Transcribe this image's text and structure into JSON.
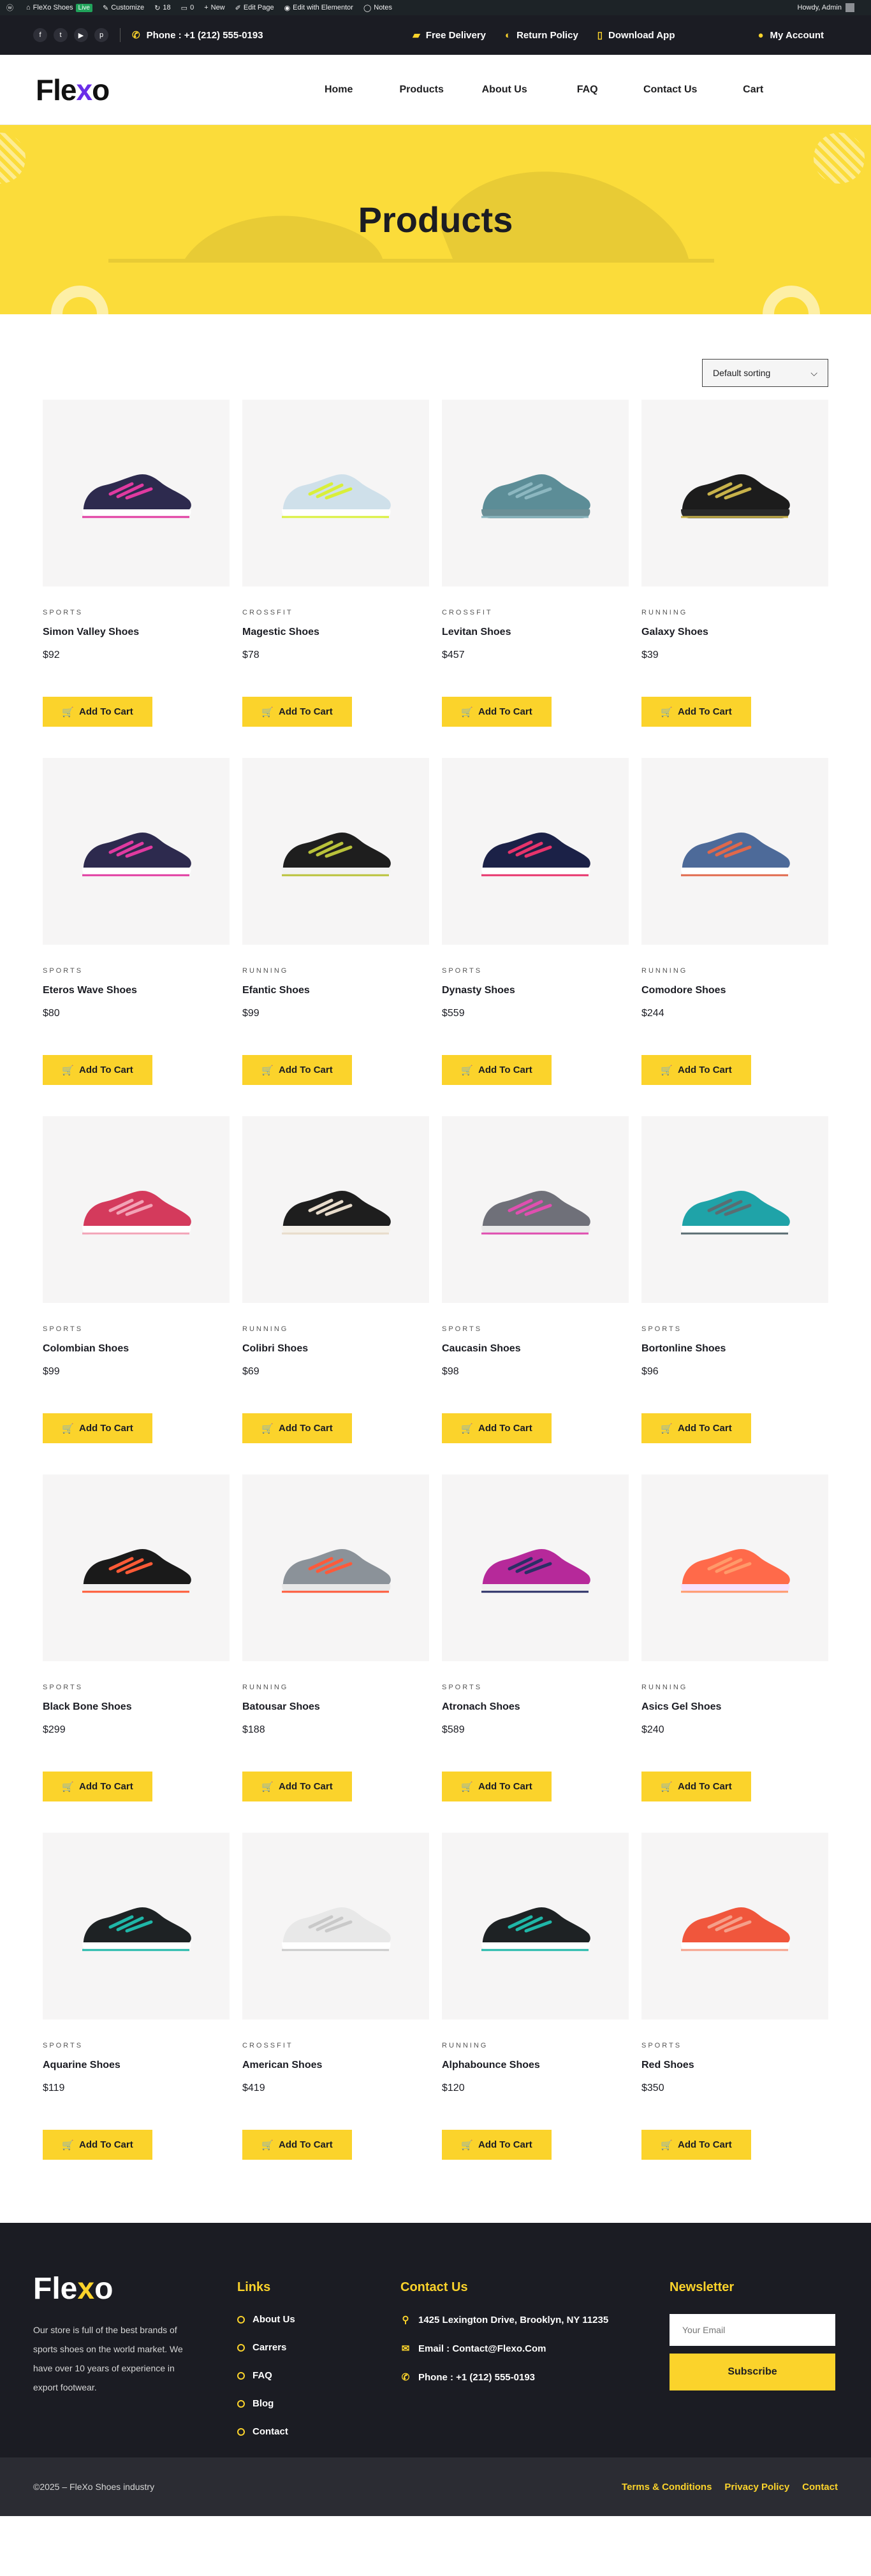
{
  "adminbar": {
    "site_name": "FleXo Shoes",
    "live_label": "Live",
    "customize": "Customize",
    "updates": "18",
    "comments": "0",
    "new": "New",
    "edit_page": "Edit Page",
    "edit_elementor": "Edit with Elementor",
    "notes": "Notes",
    "howdy": "Howdy, Admin"
  },
  "topbar": {
    "phone": "Phone : +1 (212) 555-0193",
    "free_delivery": "Free Delivery",
    "return_policy": "Return Policy",
    "download_app": "Download App",
    "my_account": "My Account"
  },
  "header": {
    "logo_main": "Fle",
    "logo_x": "x",
    "logo_end": "o",
    "nav": [
      "Home",
      "Products",
      "About Us",
      "FAQ",
      "Contact Us",
      "Cart"
    ]
  },
  "hero": {
    "title": "Products"
  },
  "sorting": {
    "selected": "Default sorting"
  },
  "add_to_cart": "Add To Cart",
  "colors": {
    "accent": "#fbd32b",
    "dark": "#1b1c23",
    "logo_x": "#6a2ee8"
  },
  "products": [
    {
      "cat": "SPORTS",
      "name": "Simon Valley Shoes",
      "price": "$92",
      "shoe": [
        "#2d2a4e",
        "#e03aa0",
        "#ffffff"
      ]
    },
    {
      "cat": "CROSSFIT",
      "name": "Magestic Shoes",
      "price": "$78",
      "shoe": [
        "#cfe0ea",
        "#d9ef3a",
        "#ffffff"
      ]
    },
    {
      "cat": "CROSSFIT",
      "name": "Levitan Shoes",
      "price": "$457",
      "shoe": [
        "#5c8d97",
        "#8cb7c0",
        "#6b8f96"
      ]
    },
    {
      "cat": "RUNNING",
      "name": "Galaxy Shoes",
      "price": "$39",
      "shoe": [
        "#1c1c1c",
        "#c8b24a",
        "#2a2a2a"
      ]
    },
    {
      "cat": "SPORTS",
      "name": "Eteros Wave Shoes",
      "price": "$80",
      "shoe": [
        "#2d2a4e",
        "#e03aa0",
        "#ffffff"
      ]
    },
    {
      "cat": "RUNNING",
      "name": "Efantic Shoes",
      "price": "$99",
      "shoe": [
        "#1e1e1e",
        "#b9c23a",
        "#f2f2f2"
      ]
    },
    {
      "cat": "SPORTS",
      "name": "Dynasty Shoes",
      "price": "$559",
      "shoe": [
        "#1b2147",
        "#e7336b",
        "#ffffff"
      ]
    },
    {
      "cat": "RUNNING",
      "name": "Comodore Shoes",
      "price": "$244",
      "shoe": [
        "#4d6a99",
        "#e0684b",
        "#ffffff"
      ]
    },
    {
      "cat": "SPORTS",
      "name": "Colombian Shoes",
      "price": "$99",
      "shoe": [
        "#d43a5c",
        "#f2a3b6",
        "#ffffff"
      ]
    },
    {
      "cat": "RUNNING",
      "name": "Colibri Shoes",
      "price": "$69",
      "shoe": [
        "#1e1e1e",
        "#e8dccb",
        "#f5f1ea"
      ]
    },
    {
      "cat": "SPORTS",
      "name": "Caucasin Shoes",
      "price": "$98",
      "shoe": [
        "#6f7079",
        "#e04fb0",
        "#eaeaea"
      ]
    },
    {
      "cat": "SPORTS",
      "name": "Bortonline Shoes",
      "price": "$96",
      "shoe": [
        "#1fa3a8",
        "#5a6d72",
        "#ffffff"
      ]
    },
    {
      "cat": "SPORTS",
      "name": "Black Bone Shoes",
      "price": "$299",
      "shoe": [
        "#1a1a1a",
        "#ff5a36",
        "#f2f2f2"
      ]
    },
    {
      "cat": "RUNNING",
      "name": "Batousar Shoes",
      "price": "$188",
      "shoe": [
        "#8b9299",
        "#ff5a3a",
        "#e8e8e8"
      ]
    },
    {
      "cat": "SPORTS",
      "name": "Atronach Shoes",
      "price": "$589",
      "shoe": [
        "#b6299a",
        "#2a2f66",
        "#f0f0f0"
      ]
    },
    {
      "cat": "RUNNING",
      "name": "Asics Gel Shoes",
      "price": "$240",
      "shoe": [
        "#ff6a4a",
        "#ff9a6a",
        "#f7e1ff"
      ]
    },
    {
      "cat": "SPORTS",
      "name": "Aquarine Shoes",
      "price": "$119",
      "shoe": [
        "#1e2224",
        "#1fb7a8",
        "#ffffff"
      ]
    },
    {
      "cat": "CROSSFIT",
      "name": "American Shoes",
      "price": "$419",
      "shoe": [
        "#e8e8e8",
        "#c9c9c9",
        "#ffffff"
      ]
    },
    {
      "cat": "RUNNING",
      "name": "Alphabounce Shoes",
      "price": "$120",
      "shoe": [
        "#1e2224",
        "#1fb7a8",
        "#ffffff"
      ]
    },
    {
      "cat": "SPORTS",
      "name": "Red Shoes",
      "price": "$350",
      "shoe": [
        "#f0563c",
        "#f5a08a",
        "#ffffff"
      ]
    }
  ],
  "footer": {
    "logo_main": "Fle",
    "logo_x": "x",
    "logo_end": "o",
    "description": "Our store is full of the best brands of sports shoes on the world market. We have over 10 years of experience in export footwear.",
    "links_title": "Links",
    "links": [
      "About Us",
      "Carrers",
      "FAQ",
      "Blog",
      "Contact"
    ],
    "contact_title": "Contact Us",
    "address": "1425 Lexington Drive, Brooklyn, NY 11235",
    "email": "Email : Contact@Flexo.Com",
    "phone": "Phone : +1 (212) 555-0193",
    "newsletter_title": "Newsletter",
    "email_placeholder": "Your Email",
    "subscribe": "Subscribe",
    "copyright": "©2025 – FleXo Shoes industry",
    "bottom_links": [
      "Terms & Conditions",
      "Privacy Policy",
      "Contact"
    ]
  }
}
